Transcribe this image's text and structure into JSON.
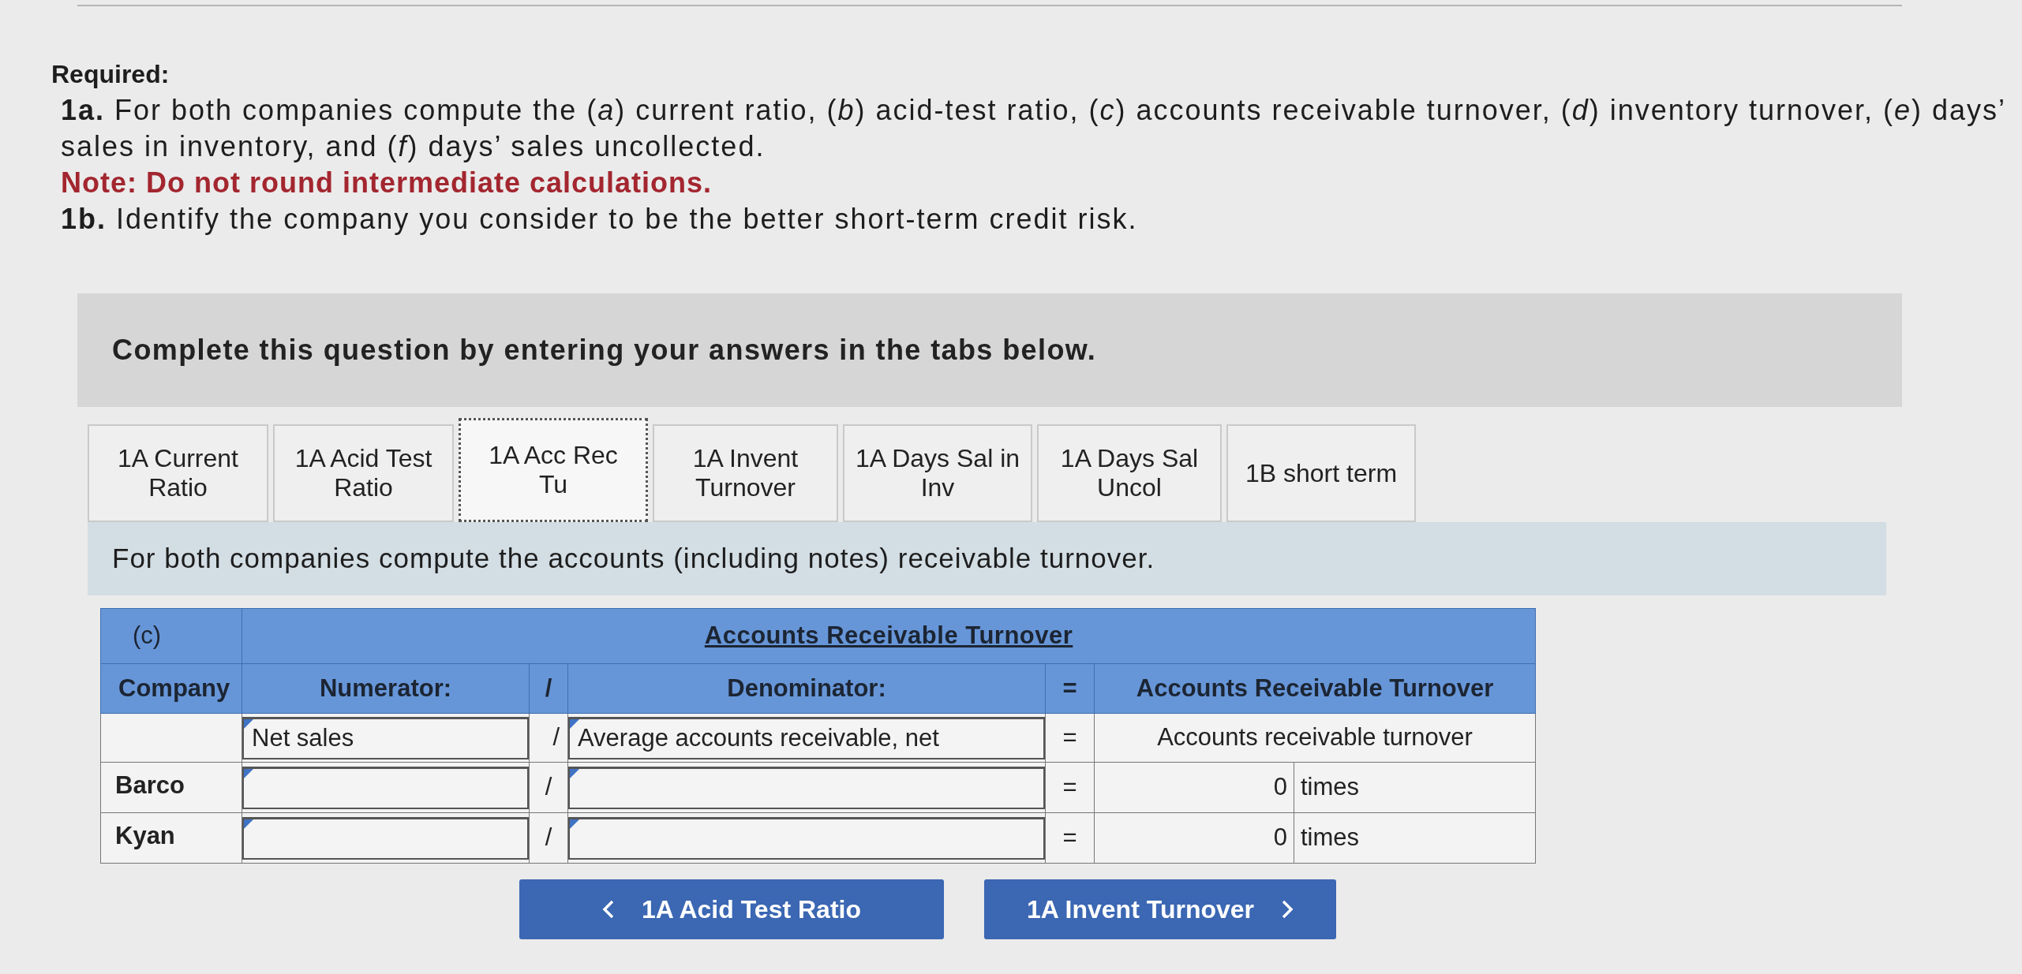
{
  "required": {
    "heading": "Required:",
    "items": [
      {
        "kind": "part",
        "text": "**1a.** For both companies compute the (*a*) current ratio, (*b*) acid-test ratio, (*c*) accounts receivable turnover, (*d*) inventory turnover, (*e*) days’ sales in inventory, and (*f*) days’ sales uncollected."
      },
      {
        "kind": "note",
        "text": "**Note: Do not round intermediate calculations.**"
      },
      {
        "kind": "part",
        "text": "**1b.** Identify the company you consider to be the better short-term credit risk."
      }
    ]
  },
  "instruction_panel": {
    "text": "Complete this question by entering your answers in the tabs below."
  },
  "tabs": [
    {
      "label": "1A Current Ratio",
      "selected": false
    },
    {
      "label": "1A Acid Test Ratio",
      "selected": false
    },
    {
      "label": "1A Acc Rec Tu",
      "selected": true
    },
    {
      "label": "1A Invent Turnover",
      "selected": false
    },
    {
      "label": "1A Days Sal in Inv",
      "selected": false
    },
    {
      "label": "1A Days Sal Uncol",
      "selected": false
    },
    {
      "label": "1B short term",
      "selected": false
    }
  ],
  "tab_panel": {
    "prompt": "For both companies compute the accounts (including notes) receivable turnover.",
    "table": {
      "section_label": "(c)",
      "title": "Accounts Receivable Turnover",
      "columns": [
        "Company",
        "Numerator:",
        "/",
        "Denominator:",
        "=",
        "Accounts Receivable Turnover"
      ],
      "formula_row": {
        "numerator": "Net sales",
        "operator_1": "/",
        "denominator": "Average accounts receivable, net",
        "operator_2": "=",
        "result": "Accounts receivable turnover"
      },
      "rows": [
        {
          "company": "Barco",
          "operator_1": "/",
          "operator_2": "=",
          "result": "0",
          "unit": "times"
        },
        {
          "company": "Kyan",
          "operator_1": "/",
          "operator_2": "=",
          "result": "0",
          "unit": "times"
        }
      ]
    }
  },
  "nav_buttons": [
    {
      "kind": "previous",
      "label": "1A Acid Test Ratio"
    },
    {
      "kind": "next",
      "label": "1A Invent Turnover"
    }
  ]
}
